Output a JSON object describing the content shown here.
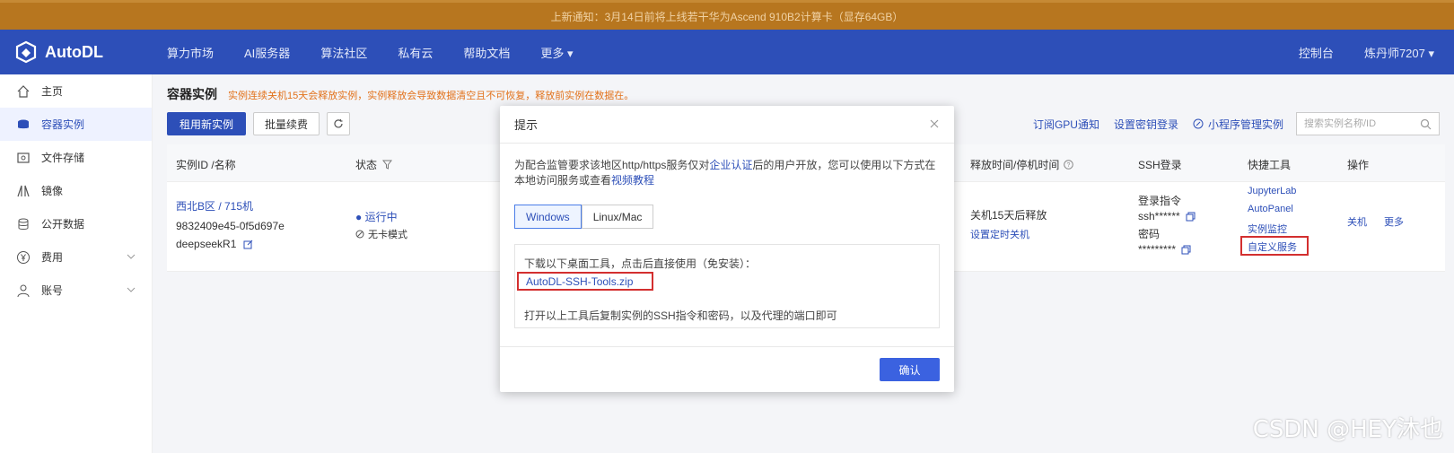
{
  "notice": "上新通知：3月14日前将上线若干华为Ascend 910B2计算卡（显存64GB）",
  "navbar": {
    "logo_text": "AutoDL",
    "items": [
      "算力市场",
      "AI服务器",
      "算法社区",
      "私有云",
      "帮助文档",
      "更多 ▾"
    ],
    "right": [
      "控制台",
      "炼丹师7207 ▾"
    ]
  },
  "sidebar": {
    "items": [
      {
        "label": "主页",
        "icon": "home-icon"
      },
      {
        "label": "容器实例",
        "icon": "container-icon"
      },
      {
        "label": "文件存储",
        "icon": "storage-icon"
      },
      {
        "label": "镜像",
        "icon": "image-icon"
      },
      {
        "label": "公开数据",
        "icon": "database-icon"
      },
      {
        "label": "费用",
        "icon": "yen-icon"
      },
      {
        "label": "账号",
        "icon": "user-icon"
      }
    ]
  },
  "page": {
    "title": "容器实例",
    "warning": "实例连续关机15天会释放实例，实例释放会导致数据清空且不可恢复，释放前实例在数据在。"
  },
  "toolbar": {
    "rent_new": "租用新实例",
    "batch_renew": "批量续费",
    "subscribe_gpu": "订阅GPU通知",
    "set_key_login": "设置密钥登录",
    "mini_program": "小程序管理实例",
    "search_placeholder": "搜索实例名称/ID"
  },
  "table": {
    "headers": {
      "id_name": "实例ID /名称",
      "status": "状态",
      "release": "释放时间/停机时间",
      "ssh": "SSH登录",
      "shortcuts": "快捷工具",
      "ops": "操作"
    },
    "row": {
      "region_name": "西北B区 / 715机",
      "instance_id": "9832409e45-0f5d697e",
      "instance_name": "deepseekR1",
      "status": "● 运行中",
      "mode": "无卡模式",
      "release_text": "关机15天后释放",
      "set_shutdown": "设置定时关机",
      "ssh_cmd_label": "登录指令",
      "ssh_cmd_value": "ssh******",
      "pwd_label": "密码",
      "pwd_value": "*********",
      "tools": [
        "JupyterLab",
        "AutoPanel",
        "实例监控",
        "自定义服务"
      ],
      "ops": [
        "关机",
        "更多"
      ]
    }
  },
  "modal": {
    "title": "提示",
    "desc_pre": "为配合监管要求该地区http/https服务仅对",
    "desc_link1": "企业认证",
    "desc_mid": "后的用户开放，您可以使用以下方式在本地访问服务或查看",
    "desc_link2": "视频教程",
    "tabs": [
      "Windows",
      "Linux/Mac"
    ],
    "download_text": "下载以下桌面工具，点击后直接使用（免安装）：",
    "zip_name": "AutoDL-SSH-Tools.zip",
    "instruction": "打开以上工具后复制实例的SSH指令和密码，以及代理的端口即可",
    "confirm": "确认"
  },
  "watermark": "CSDN @HEY沐也",
  "colors": {
    "brand": "#2d4fb8",
    "notice_bg": "#b7761f",
    "highlight": "#d32f2f"
  }
}
